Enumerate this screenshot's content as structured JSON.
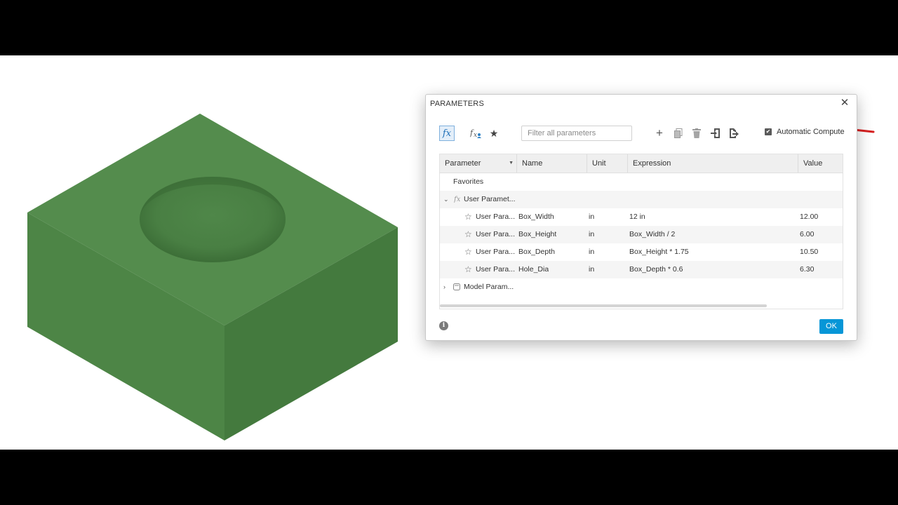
{
  "dialog": {
    "title": "PARAMETERS",
    "close_glyph": "✕",
    "filter_placeholder": "Filter all parameters",
    "auto_compute_label": "Automatic Compute",
    "auto_compute_checked": true,
    "ok_label": "OK"
  },
  "toolbar_icons": [
    "fx-all-icon",
    "fx-user-icon",
    "star-favorites-icon",
    "add-icon",
    "copy-icon",
    "delete-icon",
    "import-icon",
    "export-icon"
  ],
  "table": {
    "columns": [
      "Parameter",
      "Name",
      "Unit",
      "Expression",
      "Value"
    ],
    "favorites_label": "Favorites",
    "user_group_label": "User Paramet...",
    "model_group_label": "Model Param...",
    "rows": [
      {
        "parameter": "User Para...",
        "name": "Box_Width",
        "unit": "in",
        "expression": "12 in",
        "value": "12.00"
      },
      {
        "parameter": "User Para...",
        "name": "Box_Height",
        "unit": "in",
        "expression": "Box_Width / 2",
        "value": "6.00"
      },
      {
        "parameter": "User Para...",
        "name": "Box_Depth",
        "unit": "in",
        "expression": "Box_Height * 1.75",
        "value": "10.50"
      },
      {
        "parameter": "User Para...",
        "name": "Hole_Dia",
        "unit": "in",
        "expression": "Box_Depth * 0.6",
        "value": "6.30"
      }
    ]
  },
  "colors": {
    "model_top": "#548c4d",
    "model_left": "#4d8546",
    "model_right": "#447a3e",
    "accent": "#0696d7",
    "annotation": "#d62020"
  }
}
